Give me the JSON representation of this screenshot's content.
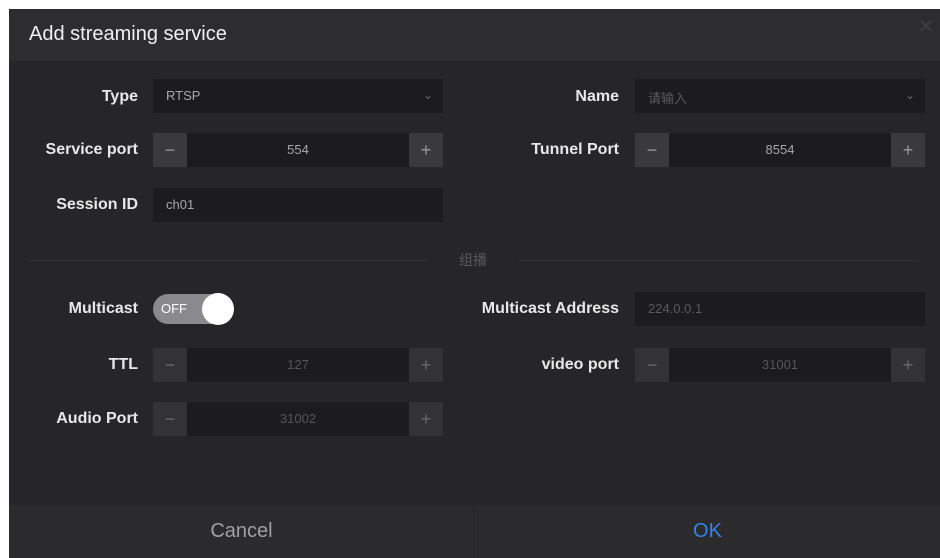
{
  "dialog": {
    "title": "Add streaming service",
    "close_icon": "close-icon"
  },
  "form": {
    "type": {
      "label": "Type",
      "value": "RTSP"
    },
    "name": {
      "label": "Name",
      "placeholder": "请输入"
    },
    "service_port": {
      "label": "Service port",
      "value": "554",
      "minus": "−",
      "plus": "+"
    },
    "tunnel_port": {
      "label": "Tunnel Port",
      "value": "8554",
      "minus": "−",
      "plus": "+"
    },
    "session_id": {
      "label": "Session ID",
      "value": "ch01"
    },
    "section_title": "组播",
    "multicast": {
      "label": "Multicast",
      "state": "OFF"
    },
    "multicast_address": {
      "label": "Multicast Address",
      "value": "224.0.0.1"
    },
    "ttl": {
      "label": "TTL",
      "value": "127",
      "minus": "−",
      "plus": "+"
    },
    "video_port": {
      "label": "video port",
      "value": "31001",
      "minus": "−",
      "plus": "+"
    },
    "audio_port": {
      "label": "Audio Port",
      "value": "31002",
      "minus": "−",
      "plus": "+"
    }
  },
  "footer": {
    "cancel_label": "Cancel",
    "ok_label": "OK"
  },
  "colors": {
    "background": "#262628",
    "accent": "#2f86e8",
    "field": "#1c1c1e"
  }
}
